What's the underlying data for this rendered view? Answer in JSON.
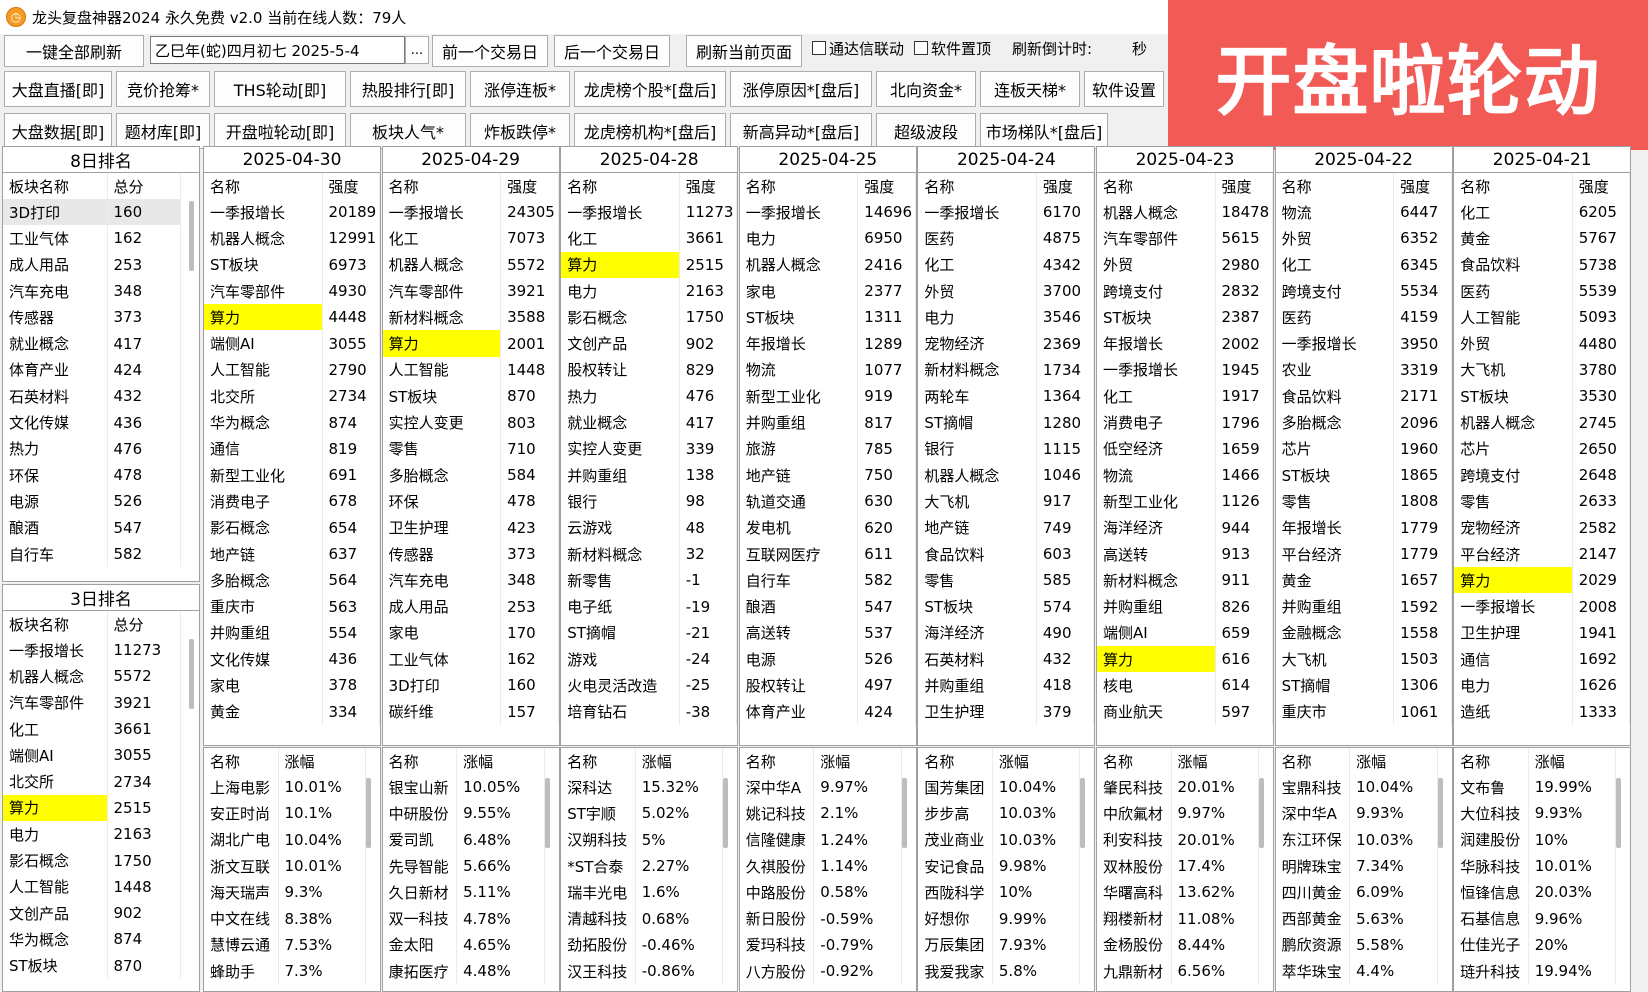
{
  "window_title": "龙头复盘神器2024 永久免费 v2.0 当前在线人数：79人",
  "banner_text": "开盘啦轮动",
  "toolbar": {
    "refresh_all": "一键全部刷新",
    "date_value": "乙巳年(蛇)四月初七  2025-5-4",
    "ellipsis": "...",
    "prev_day": "前一个交易日",
    "next_day": "后一个交易日",
    "refresh_page": "刷新当前页面",
    "tdx_link": "通达信联动",
    "pin_top": "软件置顶",
    "countdown_label": "刷新倒计时:",
    "countdown_unit": "秒"
  },
  "nav_row1": [
    "大盘直播[即]",
    "竞价抢筹*",
    "THS轮动[即]",
    "热股排行[即]",
    "涨停连板*",
    "龙虎榜个股*[盘后]",
    "涨停原因*[盘后]",
    "北向资金*",
    "连板天梯*",
    "软件设置"
  ],
  "nav_row2": [
    "大盘数据[即]",
    "题材库[即]",
    "开盘啦轮动[即]",
    "板块人气*",
    "炸板跌停*",
    "龙虎榜机构*[盘后]",
    "新高异动*[盘后]",
    "超级波段",
    "市场梯队*[盘后]"
  ],
  "rank8": {
    "title": "8日排名",
    "headers": [
      "板块名称",
      "总分"
    ],
    "rows": [
      [
        "3D打印",
        "160"
      ],
      [
        "工业气体",
        "162"
      ],
      [
        "成人用品",
        "253"
      ],
      [
        "汽车充电",
        "348"
      ],
      [
        "传感器",
        "373"
      ],
      [
        "就业概念",
        "417"
      ],
      [
        "体育产业",
        "424"
      ],
      [
        "石英材料",
        "432"
      ],
      [
        "文化传媒",
        "436"
      ],
      [
        "热力",
        "476"
      ],
      [
        "环保",
        "478"
      ],
      [
        "电源",
        "526"
      ],
      [
        "酿酒",
        "547"
      ],
      [
        "自行车",
        "582"
      ]
    ]
  },
  "rank3": {
    "title": "3日排名",
    "headers": [
      "板块名称",
      "总分"
    ],
    "rows": [
      [
        "一季报增长",
        "11273"
      ],
      [
        "机器人概念",
        "5572"
      ],
      [
        "汽车零部件",
        "3921"
      ],
      [
        "化工",
        "3661"
      ],
      [
        "端侧AI",
        "3055"
      ],
      [
        "北交所",
        "2734"
      ],
      [
        "算力",
        "2515"
      ],
      [
        "电力",
        "2163"
      ],
      [
        "影石概念",
        "1750"
      ],
      [
        "人工智能",
        "1448"
      ],
      [
        "文创产品",
        "902"
      ],
      [
        "华为概念",
        "874"
      ],
      [
        "ST板块",
        "870"
      ]
    ]
  },
  "sector_headers": [
    "名称",
    "强度"
  ],
  "stock_headers": [
    "名称",
    "涨幅"
  ],
  "highlight_term": "算力",
  "days": [
    {
      "date": "2025-04-30",
      "sectors": [
        [
          "一季报增长",
          "20189"
        ],
        [
          "机器人概念",
          "12991"
        ],
        [
          "ST板块",
          "6973"
        ],
        [
          "汽车零部件",
          "4930"
        ],
        [
          "算力",
          "4448"
        ],
        [
          "端侧AI",
          "3055"
        ],
        [
          "人工智能",
          "2790"
        ],
        [
          "北交所",
          "2734"
        ],
        [
          "华为概念",
          "874"
        ],
        [
          "通信",
          "819"
        ],
        [
          "新型工业化",
          "691"
        ],
        [
          "消费电子",
          "678"
        ],
        [
          "影石概念",
          "654"
        ],
        [
          "地产链",
          "637"
        ],
        [
          "多胎概念",
          "564"
        ],
        [
          "重庆市",
          "563"
        ],
        [
          "并购重组",
          "554"
        ],
        [
          "文化传媒",
          "436"
        ],
        [
          "家电",
          "378"
        ],
        [
          "黄金",
          "334"
        ]
      ],
      "stocks": [
        [
          "上海电影",
          "10.01%"
        ],
        [
          "安正时尚",
          "10.1%"
        ],
        [
          "湖北广电",
          "10.04%"
        ],
        [
          "浙文互联",
          "10.01%"
        ],
        [
          "海天瑞声",
          "9.3%"
        ],
        [
          "中文在线",
          "8.38%"
        ],
        [
          "慧博云通",
          "7.53%"
        ],
        [
          "蜂助手",
          "7.3%"
        ]
      ]
    },
    {
      "date": "2025-04-29",
      "sectors": [
        [
          "一季报增长",
          "24305"
        ],
        [
          "化工",
          "7073"
        ],
        [
          "机器人概念",
          "5572"
        ],
        [
          "汽车零部件",
          "3921"
        ],
        [
          "新材料概念",
          "3588"
        ],
        [
          "算力",
          "2001"
        ],
        [
          "人工智能",
          "1448"
        ],
        [
          "ST板块",
          "870"
        ],
        [
          "实控人变更",
          "803"
        ],
        [
          "零售",
          "710"
        ],
        [
          "多胎概念",
          "584"
        ],
        [
          "环保",
          "478"
        ],
        [
          "卫生护理",
          "423"
        ],
        [
          "传感器",
          "373"
        ],
        [
          "汽车充电",
          "348"
        ],
        [
          "成人用品",
          "253"
        ],
        [
          "家电",
          "170"
        ],
        [
          "工业气体",
          "162"
        ],
        [
          "3D打印",
          "160"
        ],
        [
          "碳纤维",
          "157"
        ]
      ],
      "stocks": [
        [
          "银宝山新",
          "10.05%"
        ],
        [
          "中研股份",
          "9.55%"
        ],
        [
          "爱司凯",
          "6.48%"
        ],
        [
          "先导智能",
          "5.66%"
        ],
        [
          "久日新材",
          "5.11%"
        ],
        [
          "双一科技",
          "4.78%"
        ],
        [
          "金太阳",
          "4.65%"
        ],
        [
          "康拓医疗",
          "4.48%"
        ]
      ]
    },
    {
      "date": "2025-04-28",
      "sectors": [
        [
          "一季报增长",
          "11273"
        ],
        [
          "化工",
          "3661"
        ],
        [
          "算力",
          "2515"
        ],
        [
          "电力",
          "2163"
        ],
        [
          "影石概念",
          "1750"
        ],
        [
          "文创产品",
          "902"
        ],
        [
          "股权转让",
          "829"
        ],
        [
          "热力",
          "476"
        ],
        [
          "就业概念",
          "417"
        ],
        [
          "实控人变更",
          "339"
        ],
        [
          "并购重组",
          "138"
        ],
        [
          "银行",
          "98"
        ],
        [
          "云游戏",
          "48"
        ],
        [
          "新材料概念",
          "32"
        ],
        [
          "新零售",
          "-1"
        ],
        [
          "电子纸",
          "-19"
        ],
        [
          "ST摘帽",
          "-21"
        ],
        [
          "游戏",
          "-24"
        ],
        [
          "火电灵活改造",
          "-25"
        ],
        [
          "培育钻石",
          "-38"
        ]
      ],
      "stocks": [
        [
          "深科达",
          "15.32%"
        ],
        [
          "ST宇顺",
          "5.02%"
        ],
        [
          "汉朔科技",
          "5%"
        ],
        [
          "*ST合泰",
          "2.27%"
        ],
        [
          "瑞丰光电",
          "1.6%"
        ],
        [
          "清越科技",
          "0.68%"
        ],
        [
          "劲拓股份",
          "-0.46%"
        ],
        [
          "汉王科技",
          "-0.86%"
        ]
      ]
    },
    {
      "date": "2025-04-25",
      "sectors": [
        [
          "一季报增长",
          "14696"
        ],
        [
          "电力",
          "6950"
        ],
        [
          "机器人概念",
          "2416"
        ],
        [
          "家电",
          "2377"
        ],
        [
          "ST板块",
          "1311"
        ],
        [
          "年报增长",
          "1289"
        ],
        [
          "物流",
          "1077"
        ],
        [
          "新型工业化",
          "919"
        ],
        [
          "并购重组",
          "817"
        ],
        [
          "旅游",
          "785"
        ],
        [
          "地产链",
          "750"
        ],
        [
          "轨道交通",
          "630"
        ],
        [
          "发电机",
          "620"
        ],
        [
          "互联网医疗",
          "611"
        ],
        [
          "自行车",
          "582"
        ],
        [
          "酿酒",
          "547"
        ],
        [
          "高送转",
          "537"
        ],
        [
          "电源",
          "526"
        ],
        [
          "股权转让",
          "497"
        ],
        [
          "体育产业",
          "424"
        ]
      ],
      "stocks": [
        [
          "深中华A",
          "9.97%"
        ],
        [
          "姚记科技",
          "2.1%"
        ],
        [
          "信隆健康",
          "1.24%"
        ],
        [
          "久祺股份",
          "1.14%"
        ],
        [
          "中路股份",
          "0.58%"
        ],
        [
          "新日股份",
          "-0.59%"
        ],
        [
          "爱玛科技",
          "-0.79%"
        ],
        [
          "八方股份",
          "-0.92%"
        ]
      ]
    },
    {
      "date": "2025-04-24",
      "sectors": [
        [
          "一季报增长",
          "6170"
        ],
        [
          "医药",
          "4875"
        ],
        [
          "化工",
          "4342"
        ],
        [
          "外贸",
          "3700"
        ],
        [
          "电力",
          "3546"
        ],
        [
          "宠物经济",
          "2369"
        ],
        [
          "新材料概念",
          "1734"
        ],
        [
          "两轮车",
          "1364"
        ],
        [
          "ST摘帽",
          "1280"
        ],
        [
          "银行",
          "1115"
        ],
        [
          "机器人概念",
          "1046"
        ],
        [
          "大飞机",
          "917"
        ],
        [
          "地产链",
          "749"
        ],
        [
          "食品饮料",
          "603"
        ],
        [
          "零售",
          "585"
        ],
        [
          "ST板块",
          "574"
        ],
        [
          "海洋经济",
          "490"
        ],
        [
          "石英材料",
          "432"
        ],
        [
          "并购重组",
          "418"
        ],
        [
          "卫生护理",
          "379"
        ]
      ],
      "stocks": [
        [
          "国芳集团",
          "10.04%"
        ],
        [
          "步步高",
          "10.03%"
        ],
        [
          "茂业商业",
          "10.03%"
        ],
        [
          "安记食品",
          "9.98%"
        ],
        [
          "西陇科学",
          "10%"
        ],
        [
          "好想你",
          "9.99%"
        ],
        [
          "万辰集团",
          "7.93%"
        ],
        [
          "我爱我家",
          "5.8%"
        ]
      ]
    },
    {
      "date": "2025-04-23",
      "sectors": [
        [
          "机器人概念",
          "18478"
        ],
        [
          "汽车零部件",
          "5615"
        ],
        [
          "外贸",
          "2980"
        ],
        [
          "跨境支付",
          "2832"
        ],
        [
          "ST板块",
          "2387"
        ],
        [
          "年报增长",
          "2002"
        ],
        [
          "一季报增长",
          "1945"
        ],
        [
          "化工",
          "1917"
        ],
        [
          "消费电子",
          "1796"
        ],
        [
          "低空经济",
          "1659"
        ],
        [
          "物流",
          "1466"
        ],
        [
          "新型工业化",
          "1126"
        ],
        [
          "海洋经济",
          "944"
        ],
        [
          "高送转",
          "913"
        ],
        [
          "新材料概念",
          "911"
        ],
        [
          "并购重组",
          "826"
        ],
        [
          "端侧AI",
          "659"
        ],
        [
          "算力",
          "616"
        ],
        [
          "核电",
          "614"
        ],
        [
          "商业航天",
          "597"
        ]
      ],
      "stocks": [
        [
          "肇民科技",
          "20.01%"
        ],
        [
          "中欣氟材",
          "9.97%"
        ],
        [
          "利安科技",
          "20.01%"
        ],
        [
          "双林股份",
          "17.4%"
        ],
        [
          "华曙高科",
          "13.62%"
        ],
        [
          "翔楼新材",
          "11.08%"
        ],
        [
          "金杨股份",
          "8.44%"
        ],
        [
          "九鼎新材",
          "6.56%"
        ]
      ]
    },
    {
      "date": "2025-04-22",
      "sectors": [
        [
          "物流",
          "6447"
        ],
        [
          "外贸",
          "6352"
        ],
        [
          "化工",
          "6345"
        ],
        [
          "跨境支付",
          "5534"
        ],
        [
          "医药",
          "4159"
        ],
        [
          "一季报增长",
          "3950"
        ],
        [
          "农业",
          "3319"
        ],
        [
          "食品饮料",
          "2171"
        ],
        [
          "多胎概念",
          "2096"
        ],
        [
          "芯片",
          "1960"
        ],
        [
          "ST板块",
          "1865"
        ],
        [
          "零售",
          "1808"
        ],
        [
          "年报增长",
          "1779"
        ],
        [
          "平台经济",
          "1779"
        ],
        [
          "黄金",
          "1657"
        ],
        [
          "并购重组",
          "1592"
        ],
        [
          "金融概念",
          "1558"
        ],
        [
          "大飞机",
          "1503"
        ],
        [
          "ST摘帽",
          "1306"
        ],
        [
          "重庆市",
          "1061"
        ]
      ],
      "stocks": [
        [
          "宝鼎科技",
          "10.04%"
        ],
        [
          "深中华A",
          "9.93%"
        ],
        [
          "东江环保",
          "10.03%"
        ],
        [
          "明牌珠宝",
          "7.34%"
        ],
        [
          "四川黄金",
          "6.09%"
        ],
        [
          "西部黄金",
          "5.63%"
        ],
        [
          "鹏欣资源",
          "5.58%"
        ],
        [
          "萃华珠宝",
          "4.4%"
        ]
      ]
    },
    {
      "date": "2025-04-21",
      "sectors": [
        [
          "化工",
          "6205"
        ],
        [
          "黄金",
          "5767"
        ],
        [
          "食品饮料",
          "5738"
        ],
        [
          "医药",
          "5539"
        ],
        [
          "人工智能",
          "5093"
        ],
        [
          "外贸",
          "4480"
        ],
        [
          "大飞机",
          "3780"
        ],
        [
          "ST板块",
          "3530"
        ],
        [
          "机器人概念",
          "2745"
        ],
        [
          "芯片",
          "2650"
        ],
        [
          "跨境支付",
          "2648"
        ],
        [
          "零售",
          "2633"
        ],
        [
          "宠物经济",
          "2582"
        ],
        [
          "平台经济",
          "2147"
        ],
        [
          "算力",
          "2029"
        ],
        [
          "一季报增长",
          "2008"
        ],
        [
          "卫生护理",
          "1941"
        ],
        [
          "通信",
          "1692"
        ],
        [
          "电力",
          "1626"
        ],
        [
          "造纸",
          "1333"
        ]
      ],
      "stocks": [
        [
          "文布鲁",
          "19.99%"
        ],
        [
          "大位科技",
          "9.93%"
        ],
        [
          "润建股份",
          "10%"
        ],
        [
          "华脉科技",
          "10.01%"
        ],
        [
          "恒锋信息",
          "20.03%"
        ],
        [
          "石基信息",
          "9.96%"
        ],
        [
          "仕佳光子",
          "20%"
        ],
        [
          "琏升科技",
          "19.94%"
        ]
      ]
    }
  ]
}
